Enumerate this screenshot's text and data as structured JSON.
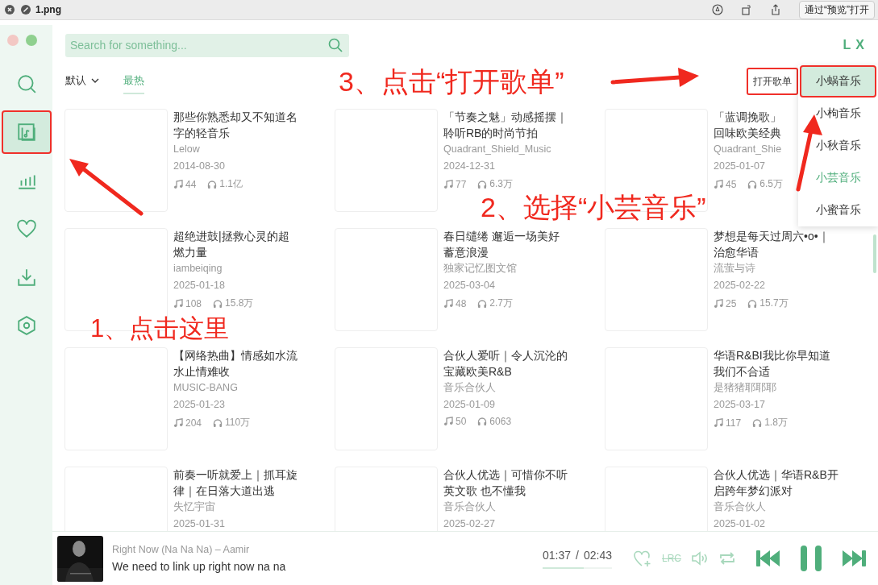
{
  "viewer": {
    "file_name": "1.png",
    "open_button": "通过“预览”打开"
  },
  "search": {
    "placeholder": "Search for something..."
  },
  "logo": "L X",
  "sidebar": {
    "items": [
      {
        "kind": "search",
        "selected": false,
        "outlined": false
      },
      {
        "kind": "playlist",
        "selected": true,
        "outlined": true
      },
      {
        "kind": "chart",
        "selected": false,
        "outlined": false
      },
      {
        "kind": "heart",
        "selected": false,
        "outlined": false
      },
      {
        "kind": "download",
        "selected": false,
        "outlined": false
      },
      {
        "kind": "settings",
        "selected": false,
        "outlined": false
      }
    ]
  },
  "sort_tabs": [
    {
      "label": "默认",
      "kind": "dropdown",
      "selected": false
    },
    {
      "label": "最热",
      "kind": "tab",
      "selected": true
    }
  ],
  "open_playlist_button": {
    "label": "打开歌单",
    "outlined": true
  },
  "source_menu": [
    {
      "label": "小蜗音乐",
      "highlighted": true,
      "selected": false,
      "outlined": true
    },
    {
      "label": "小枸音乐",
      "highlighted": false,
      "selected": false,
      "outlined": false
    },
    {
      "label": "小秋音乐",
      "highlighted": false,
      "selected": false,
      "outlined": false
    },
    {
      "label": "小芸音乐",
      "highlighted": false,
      "selected": true,
      "outlined": false
    },
    {
      "label": "小蜜音乐",
      "highlighted": false,
      "selected": false,
      "outlined": false
    }
  ],
  "playlists": [
    {
      "title_lines": [
        "那些你熟悉却又不知道名",
        "字的轻音乐"
      ],
      "author": "Lelow",
      "date": "2014-08-30",
      "songs": "44",
      "plays": "1.1亿"
    },
    {
      "title_lines": [
        "「节奏之魅」动感摇摆｜",
        "聆听RB的时尚节拍"
      ],
      "author": "Quadrant_Shield_Music",
      "date": "2024-12-31",
      "songs": "77",
      "plays": "6.3万"
    },
    {
      "title_lines": [
        "「蓝调挽歌」",
        "回味欧美经典"
      ],
      "author": "Quadrant_Shie",
      "date": "2025-01-07",
      "songs": "45",
      "plays": "6.5万"
    },
    {
      "title_lines": [
        "超绝进鼓|拯救心灵的超",
        "燃力量"
      ],
      "author": "iambeiqing",
      "date": "2025-01-18",
      "songs": "108",
      "plays": "15.8万"
    },
    {
      "title_lines": [
        "春日缱绻 邂逅一场美好",
        "蓄意浪漫"
      ],
      "author": "独家记忆图文馆",
      "date": "2025-03-04",
      "songs": "48",
      "plays": "2.7万"
    },
    {
      "title_lines": [
        "梦想是每天过周六•o•｜",
        "治愈华语"
      ],
      "author": "流萤与诗",
      "date": "2025-02-22",
      "songs": "25",
      "plays": "15.7万"
    },
    {
      "title_lines": [
        "【网络热曲】情感如水流",
        "水止情难收"
      ],
      "author": "MUSIC-BANG",
      "date": "2025-01-23",
      "songs": "204",
      "plays": "110万"
    },
    {
      "title_lines": [
        "合伙人爱听｜令人沉沦的",
        "宝藏欧美R&B"
      ],
      "author": "音乐合伙人",
      "date": "2025-01-09",
      "songs": "50",
      "plays": "6063"
    },
    {
      "title_lines": [
        "华语R&BI我比你早知道",
        "我们不合适"
      ],
      "author": "是猪猪耶耶耶",
      "date": "2025-03-17",
      "songs": "117",
      "plays": "1.8万"
    },
    {
      "title_lines": [
        "前奏一听就爱上｜抓耳旋",
        "律｜在日落大道出逃"
      ],
      "author": "失忆宇宙",
      "date": "2025-01-31"
    },
    {
      "title_lines": [
        "合伙人优选｜可惜你不听",
        "英文歌 也不懂我"
      ],
      "author": "音乐合伙人",
      "date": "2025-02-27"
    },
    {
      "title_lines": [
        "合伙人优选｜华语R&B开",
        "启跨年梦幻派对"
      ],
      "author": "音乐合伙人",
      "date": "2025-01-02"
    }
  ],
  "player": {
    "title": "Right Now (Na Na Na) – Aamir",
    "lyric": "We need to link up right now na na",
    "elapsed": "01:37",
    "separator": "/",
    "duration": "02:43",
    "level": 0.59,
    "lyric_button": "LRC"
  },
  "annotations": [
    {
      "text": "1、点击这里"
    },
    {
      "text": "2、选择“小芸音乐”"
    },
    {
      "text": "3、点击“打开歌单”"
    }
  ]
}
